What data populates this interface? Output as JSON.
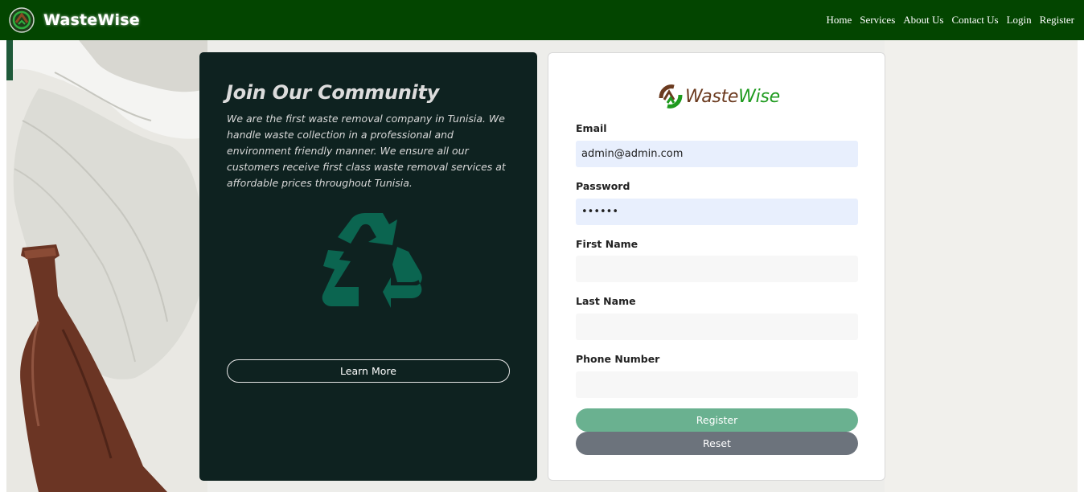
{
  "navbar": {
    "brand_name": "WasteWise",
    "links": [
      "Home",
      "Services",
      "About Us",
      "Contact Us",
      "Login",
      "Register"
    ]
  },
  "info_card": {
    "title": "Join Our Community",
    "text": "We are the first waste removal company in Tunisia. We handle waste collection in a professional and environment friendly manner. We ensure all our customers receive first class waste removal services at affordable prices throughout Tunisia.",
    "button_label": "Learn More"
  },
  "form": {
    "logo_part1": "Waste",
    "logo_part2": "Wise",
    "email": {
      "label": "Email",
      "value": "admin@admin.com"
    },
    "password": {
      "label": "Password",
      "value": "••••••"
    },
    "first_name": {
      "label": "First Name",
      "value": ""
    },
    "last_name": {
      "label": "Last Name",
      "value": ""
    },
    "phone": {
      "label": "Phone Number",
      "value": ""
    },
    "register_label": "Register",
    "reset_label": "Reset"
  },
  "colors": {
    "navbar": "#034500",
    "info_card": "#0e2220",
    "recycle_icon": "#0b6550",
    "register_button": "#6ab190",
    "reset_button": "#6c737c",
    "input_filled": "#e8effd"
  }
}
